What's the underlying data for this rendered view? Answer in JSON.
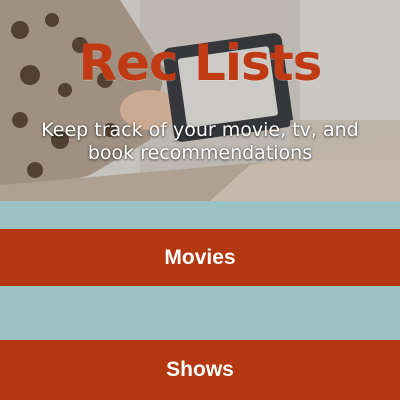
{
  "hero": {
    "title": "Rec Lists",
    "subtitle": "Keep track of your movie, tv, and book recommendations"
  },
  "nav": {
    "items": [
      {
        "label": "Movies"
      },
      {
        "label": "Shows"
      }
    ]
  },
  "colors": {
    "brand_title": "#c03a13",
    "button_bg": "#b3380f",
    "stripe_bg": "#9bc3c6",
    "button_text": "#ffffff"
  }
}
